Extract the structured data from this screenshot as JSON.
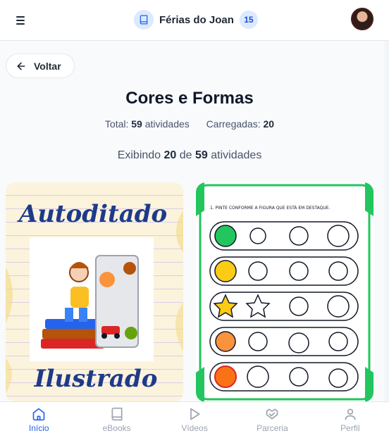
{
  "header": {
    "title": "Férias do Joan",
    "badge": "15"
  },
  "back_label": "Voltar",
  "page": {
    "title": "Cores e Formas",
    "total_label": "Total:",
    "total_value": "59",
    "total_suffix": "atividades",
    "loaded_label": "Carregadas:",
    "loaded_value": "20",
    "showing_prefix": "Exibindo",
    "showing_count": "20",
    "showing_mid": "de",
    "showing_total": "59",
    "showing_suffix": "atividades"
  },
  "cards": [
    {
      "title_line1": "Autoditado",
      "title_line2": "Ilustrado"
    },
    {
      "instruction": "1. PINTE CONFORME A FIGURA QUE ESTÁ EM DESTAQUE."
    }
  ],
  "nav": {
    "items": [
      {
        "label": "Início",
        "icon": "home-icon",
        "active": true
      },
      {
        "label": "eBooks",
        "icon": "book-icon",
        "active": false
      },
      {
        "label": "Vídeos",
        "icon": "play-icon",
        "active": false
      },
      {
        "label": "Parceria",
        "icon": "handshake-icon",
        "active": false
      },
      {
        "label": "Perfil",
        "icon": "user-icon",
        "active": false
      }
    ]
  },
  "colors": {
    "accent": "#2563eb",
    "brand_bg": "#dbeafe",
    "card_green": "#22c55e"
  }
}
